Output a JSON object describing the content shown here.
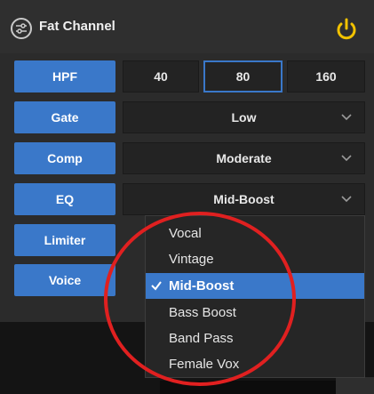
{
  "header": {
    "title": "Fat Channel",
    "icon": "sliders-icon",
    "power_icon": "power-icon",
    "accent": "#f2c200"
  },
  "sidebar": {
    "buttons": [
      {
        "label": "HPF"
      },
      {
        "label": "Gate"
      },
      {
        "label": "Comp"
      },
      {
        "label": "EQ"
      },
      {
        "label": "Limiter"
      },
      {
        "label": "Voice"
      }
    ]
  },
  "hpf": {
    "options": [
      "40",
      "80",
      "160"
    ],
    "selected": "80"
  },
  "gate": {
    "value": "Low"
  },
  "comp": {
    "value": "Moderate"
  },
  "eq": {
    "value": "Mid-Boost",
    "options": [
      "Vocal",
      "Vintage",
      "Mid-Boost",
      "Bass Boost",
      "Band Pass",
      "Female Vox"
    ],
    "selected": "Mid-Boost"
  },
  "colors": {
    "button_blue": "#3a78c9",
    "annotation_red": "#e02020"
  }
}
